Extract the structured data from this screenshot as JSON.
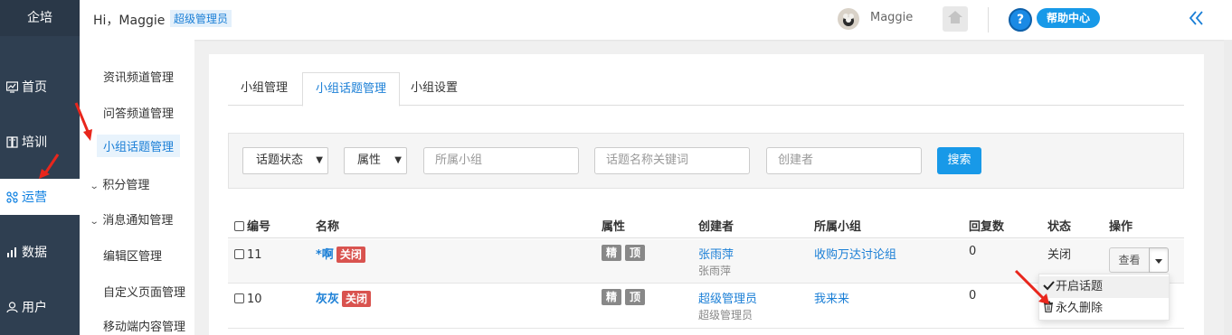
{
  "nav": {
    "brand": "企培",
    "items": [
      {
        "label": "首页",
        "icon": "dashboard-icon"
      },
      {
        "label": "培训",
        "icon": "book-icon"
      },
      {
        "label": "运营",
        "icon": "cluster-icon",
        "active": true
      },
      {
        "label": "数据",
        "icon": "bar-chart-icon"
      },
      {
        "label": "用户",
        "icon": "user-icon"
      }
    ]
  },
  "header": {
    "greeting": "Hi，Maggie",
    "role": "超级管理员",
    "username": "Maggie",
    "help_label": "帮助中心"
  },
  "submenu": {
    "items": [
      {
        "label": "资讯频道管理"
      },
      {
        "label": "问答频道管理"
      },
      {
        "label": "小组话题管理",
        "active": true
      },
      {
        "label": "积分管理",
        "group": true
      },
      {
        "label": "消息通知管理",
        "group": true
      },
      {
        "label": "编辑区管理"
      },
      {
        "label": "自定义页面管理"
      },
      {
        "label": "移动端内容管理"
      }
    ]
  },
  "tabs": [
    {
      "label": "小组管理"
    },
    {
      "label": "小组话题管理",
      "active": true
    },
    {
      "label": "小组设置"
    }
  ],
  "filters": {
    "status_select": "话题状态",
    "attr_select": "属性",
    "group_placeholder": "所属小组",
    "keyword_placeholder": "话题名称关键词",
    "creator_placeholder": "创建者",
    "search_label": "搜索"
  },
  "table": {
    "headers": {
      "id": "编号",
      "name": "名称",
      "attr": "属性",
      "creator": "创建者",
      "group": "所属小组",
      "replies": "回复数",
      "status": "状态",
      "actions": "操作"
    },
    "rows": [
      {
        "id": "11",
        "name": "*啊",
        "closed_badge": "关闭",
        "attr_essence": "精",
        "attr_top": "顶",
        "creator": "张雨萍",
        "creator_sub": "张雨萍",
        "group": "收购万达讨论组",
        "replies": "0",
        "status": "关闭",
        "view_label": "查看"
      },
      {
        "id": "10",
        "name": "灰灰",
        "closed_badge": "关闭",
        "attr_essence": "精",
        "attr_top": "顶",
        "creator": "超级管理员",
        "creator_sub": "超级管理员",
        "group": "我来来",
        "replies": "0",
        "status": "",
        "view_label": ""
      }
    ]
  },
  "dropdown": {
    "items": [
      {
        "label": "开启话题",
        "icon": "check-icon"
      },
      {
        "label": "永久删除",
        "icon": "trash-icon"
      }
    ]
  },
  "colors": {
    "nav_bg": "#2f3f51",
    "accent": "#1b7fd6",
    "button_blue": "#1899e8",
    "danger": "#d9534f",
    "annotation_arrow": "#e8261c"
  }
}
